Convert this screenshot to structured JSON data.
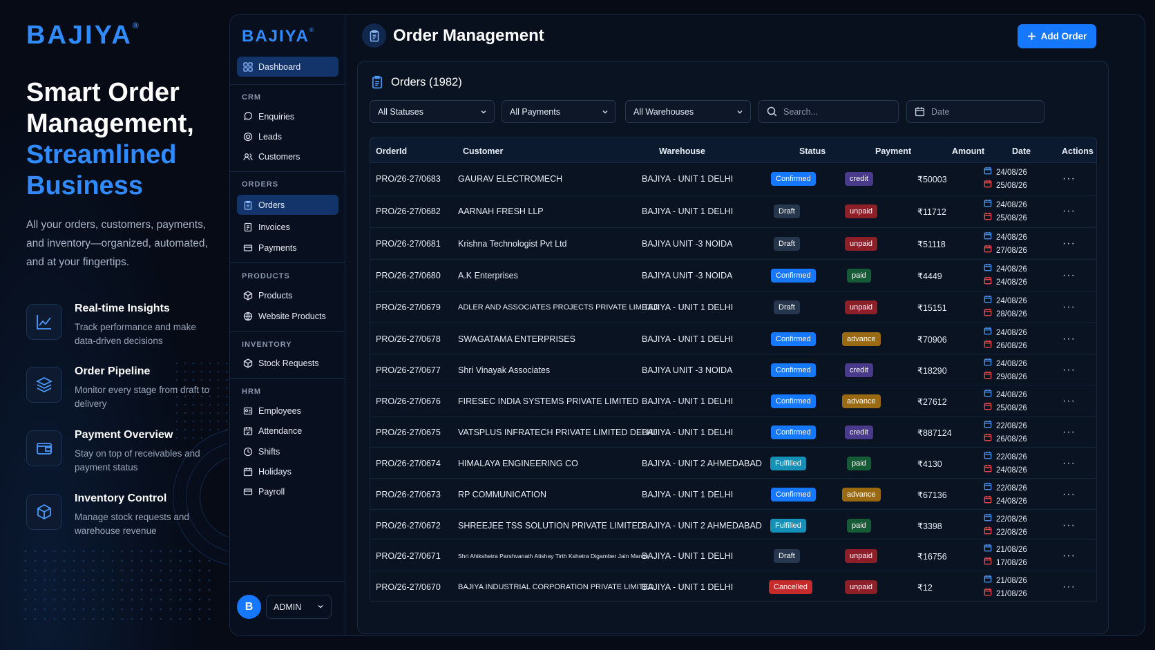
{
  "hero": {
    "logo": "BAJIYA",
    "logo_mark": "®",
    "title_line1": "Smart Order",
    "title_line2": "Management,",
    "title_accent1": "Streamlined",
    "title_accent2": "Business",
    "description": "All your orders, customers, payments, and inventory—organized, automated, and at your fingertips.",
    "features": [
      {
        "title": "Real-time Insights",
        "desc": "Track performance and make data-driven decisions",
        "icon": "chart-line-icon"
      },
      {
        "title": "Order Pipeline",
        "desc": "Monitor every stage from draft to delivery",
        "icon": "layers-icon"
      },
      {
        "title": "Payment Overview",
        "desc": "Stay on top of receivables and payment status",
        "icon": "wallet-icon"
      },
      {
        "title": "Inventory Control",
        "desc": "Manage stock requests and warehouse revenue",
        "icon": "box-icon"
      }
    ]
  },
  "sidebar": {
    "logo": "BAJIYA",
    "logo_mark": "®",
    "dashboard": "Dashboard",
    "sections": {
      "crm": "CRM",
      "orders": "ORDERS",
      "products": "PRODUCTS",
      "inventory": "INVENTORY",
      "hrm": "HRM"
    },
    "items": {
      "enquiries": "Enquiries",
      "leads": "Leads",
      "customers": "Customers",
      "orders": "Orders",
      "invoices": "Invoices",
      "payments": "Payments",
      "products": "Products",
      "website_products": "Website Products",
      "stock_requests": "Stock Requests",
      "employees": "Employees",
      "attendance": "Attendance",
      "shifts": "Shifts",
      "holidays": "Holidays",
      "payroll": "Payroll"
    },
    "user": {
      "initial": "B",
      "role": "ADMIN"
    }
  },
  "header": {
    "title": "Order Management",
    "add_button": "Add Order"
  },
  "orders": {
    "title": "Orders (1982)",
    "filters": {
      "status": "All Statuses",
      "payment": "All Payments",
      "warehouse": "All Warehouses",
      "search_placeholder": "Search...",
      "date_placeholder": "Date"
    },
    "columns": [
      "OrderId",
      "Customer",
      "Warehouse",
      "Status",
      "Payment",
      "Amount",
      "Date",
      "Actions"
    ],
    "rows": [
      {
        "id": "PRO/26-27/0683",
        "customer": "GAURAV ELECTROMECH",
        "warehouse": "BAJIYA - UNIT 1 DELHI",
        "status": "Confirmed",
        "payment": "credit",
        "amount": "₹50003",
        "date1": "24/08/26",
        "date2": "25/08/26"
      },
      {
        "id": "PRO/26-27/0682",
        "customer": "AARNAH FRESH LLP",
        "warehouse": "BAJIYA - UNIT 1 DELHI",
        "status": "Draft",
        "payment": "unpaid",
        "amount": "₹11712",
        "date1": "24/08/26",
        "date2": "25/08/26"
      },
      {
        "id": "PRO/26-27/0681",
        "customer": "Krishna Technologist Pvt Ltd",
        "warehouse": "BAJIYA UNIT -3 NOIDA",
        "status": "Draft",
        "payment": "unpaid",
        "amount": "₹51118",
        "date1": "24/08/26",
        "date2": "27/08/26"
      },
      {
        "id": "PRO/26-27/0680",
        "customer": "A.K Enterprises",
        "warehouse": "BAJIYA UNIT -3 NOIDA",
        "status": "Confirmed",
        "payment": "paid",
        "amount": "₹4449",
        "date1": "24/08/26",
        "date2": "24/08/26"
      },
      {
        "id": "PRO/26-27/0679",
        "customer": "ADLER AND ASSOCIATES PROJECTS PRIVATE LIMITED",
        "warehouse": "BAJIYA - UNIT 1 DELHI",
        "status": "Draft",
        "payment": "unpaid",
        "amount": "₹15151",
        "date1": "24/08/26",
        "date2": "28/08/26"
      },
      {
        "id": "PRO/26-27/0678",
        "customer": "SWAGATAMA ENTERPRISES",
        "warehouse": "BAJIYA - UNIT 1 DELHI",
        "status": "Confirmed",
        "payment": "advance",
        "amount": "₹70906",
        "date1": "24/08/26",
        "date2": "26/08/26"
      },
      {
        "id": "PRO/26-27/0677",
        "customer": "Shri Vinayak Associates",
        "warehouse": "BAJIYA UNIT -3 NOIDA",
        "status": "Confirmed",
        "payment": "credit",
        "amount": "₹18290",
        "date1": "24/08/26",
        "date2": "29/08/26"
      },
      {
        "id": "PRO/26-27/0676",
        "customer": "FIRESEC INDIA SYSTEMS PRIVATE LIMITED",
        "warehouse": "BAJIYA - UNIT 1 DELHI",
        "status": "Confirmed",
        "payment": "advance",
        "amount": "₹27612",
        "date1": "24/08/26",
        "date2": "25/08/26"
      },
      {
        "id": "PRO/26-27/0675",
        "customer": "VATSPLUS INFRATECH PRIVATE LIMITED DELHI",
        "warehouse": "BAJIYA - UNIT 1 DELHI",
        "status": "Confirmed",
        "payment": "credit",
        "amount": "₹887124",
        "date1": "22/08/26",
        "date2": "26/08/26"
      },
      {
        "id": "PRO/26-27/0674",
        "customer": "HIMALAYA ENGINEERING CO",
        "warehouse": "BAJIYA - UNIT 2 AHMEDABAD",
        "status": "Fulfilled",
        "payment": "paid",
        "amount": "₹4130",
        "date1": "22/08/26",
        "date2": "24/08/26"
      },
      {
        "id": "PRO/26-27/0673",
        "customer": "RP COMMUNICATION",
        "warehouse": "BAJIYA - UNIT 1 DELHI",
        "status": "Confirmed",
        "payment": "advance",
        "amount": "₹67136",
        "date1": "22/08/26",
        "date2": "24/08/26"
      },
      {
        "id": "PRO/26-27/0672",
        "customer": "SHREEJEE TSS SOLUTION PRIVATE LIMITED",
        "warehouse": "BAJIYA - UNIT 2 AHMEDABAD",
        "status": "Fulfilled",
        "payment": "paid",
        "amount": "₹3398",
        "date1": "22/08/26",
        "date2": "22/08/26"
      },
      {
        "id": "PRO/26-27/0671",
        "customer": "Shri Ahikshetra Parshvanath Atishay Tirth Kshetra Digamber Jain Mandir",
        "warehouse": "BAJIYA - UNIT 1 DELHI",
        "status": "Draft",
        "payment": "unpaid",
        "amount": "₹16756",
        "date1": "21/08/26",
        "date2": "17/08/26"
      },
      {
        "id": "PRO/26-27/0670",
        "customer": "BAJIYA INDUSTRIAL CORPORATION PRIVATE LIMITED",
        "warehouse": "BAJIYA - UNIT 1 DELHI",
        "status": "Cancelled",
        "payment": "unpaid",
        "amount": "₹12",
        "date1": "21/08/26",
        "date2": "21/08/26"
      }
    ],
    "actions_glyph": "···"
  },
  "colors": {
    "accent": "#1677ff",
    "brand": "#2f8bff",
    "status": {
      "Confirmed": "#1677ff",
      "Draft": "#26364d",
      "Fulfilled": "#1590b8",
      "Cancelled": "#c62b2b"
    },
    "payment": {
      "credit": "#4a3a8c",
      "unpaid": "#8c1f28",
      "paid": "#155c36",
      "advance": "#9a6a12"
    }
  }
}
